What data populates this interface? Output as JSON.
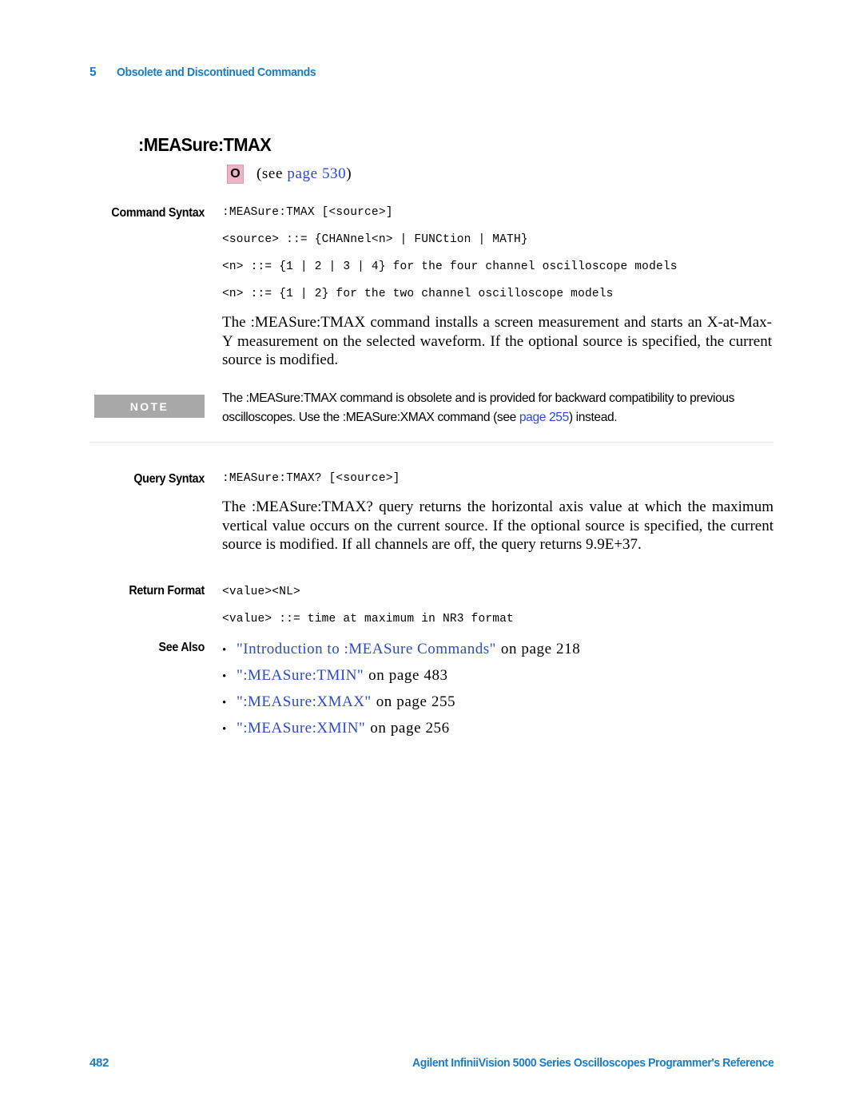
{
  "header": {
    "chapter_number": "5",
    "chapter_title": "Obsolete and Discontinued Commands"
  },
  "command": {
    "title": ":MEASure:TMAX",
    "badge_letter": "O",
    "see_prefix": "(see ",
    "see_link": "page 530",
    "see_suffix": ")"
  },
  "sections": {
    "command_syntax": {
      "label": "Command Syntax",
      "lines": [
        ":MEASure:TMAX [<source>]",
        "<source> ::= {CHANnel<n> | FUNCtion | MATH}",
        "<n> ::= {1 | 2 | 3 | 4} for the four channel oscilloscope models",
        "<n> ::= {1 | 2} for the two channel oscilloscope models"
      ],
      "description": "The :MEASure:TMAX command installs a screen measurement and starts an X-at-Max-Y measurement on the selected waveform. If the optional source is specified, the current source is modified."
    },
    "note": {
      "badge": "NOTE",
      "text_before_link": "The :MEASure:TMAX command is obsolete and is provided for backward compatibility to previous oscilloscopes. Use the :MEASure:XMAX command (see ",
      "link": "page 255",
      "text_after_link": ") instead."
    },
    "query_syntax": {
      "label": "Query Syntax",
      "line": ":MEASure:TMAX? [<source>]",
      "description": "The :MEASure:TMAX? query returns the horizontal axis value at which the maximum vertical value occurs on the current source. If the optional source is specified, the current source is modified. If all channels are off, the query returns 9.9E+37."
    },
    "return_format": {
      "label": "Return Format",
      "lines": [
        "<value><NL>",
        "<value> ::= time at maximum in NR3 format"
      ]
    },
    "see_also": {
      "label": "See Also",
      "bullet": "•",
      "items": [
        {
          "title": "\"Introduction to :MEASure Commands\"",
          "tail": "on page 218"
        },
        {
          "title": "\":MEASure:TMIN\"",
          "tail": "on page 483"
        },
        {
          "title": "\":MEASure:XMAX\"",
          "tail": "on page 255"
        },
        {
          "title": "\":MEASure:XMIN\"",
          "tail": "on page 256"
        }
      ]
    }
  },
  "footer": {
    "page_number": "482",
    "title": "Agilent InfiniiVision 5000 Series Oscilloscopes Programmer's Reference"
  },
  "colors": {
    "brand_blue": "#1b7bc4",
    "link_blue": "#2b49cf",
    "note_gray": "#a8a8a8",
    "badge_pink": "#eab6c8"
  }
}
